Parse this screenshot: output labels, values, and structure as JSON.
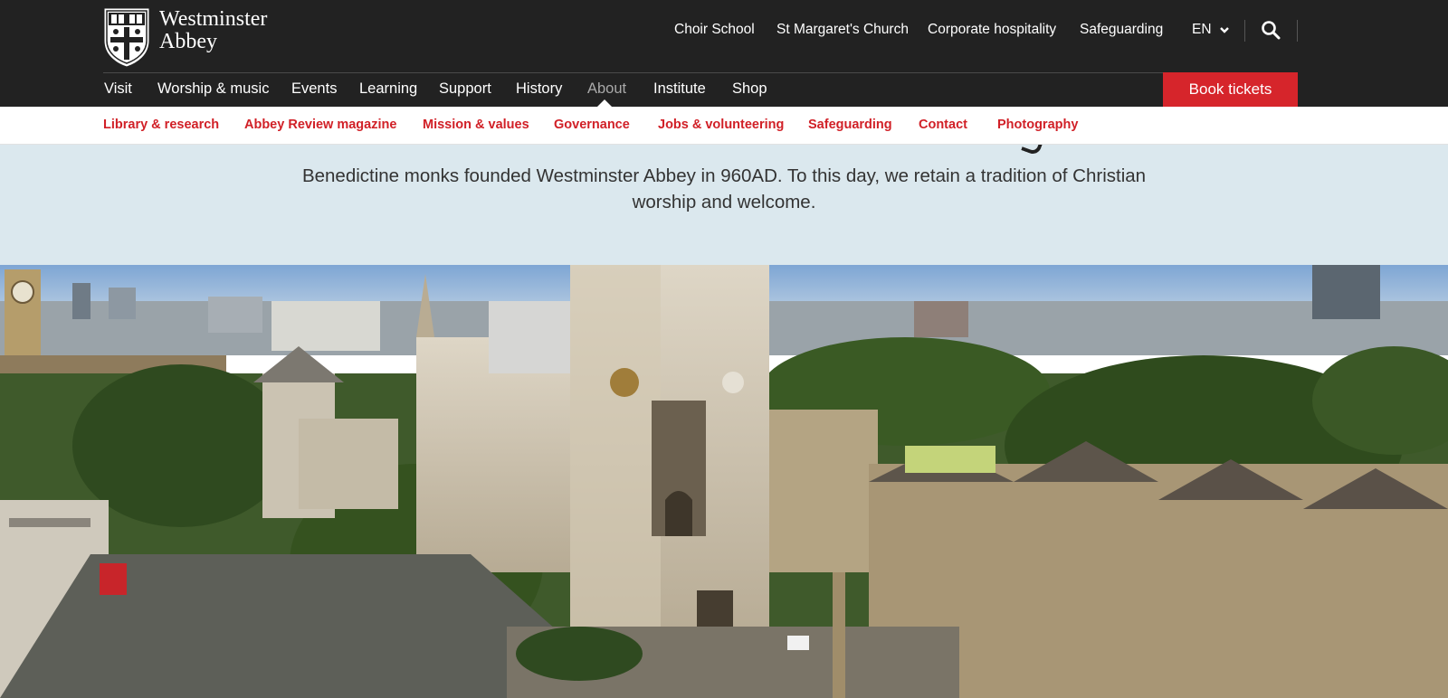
{
  "brand": {
    "line1": "Westminster",
    "line2": "Abbey"
  },
  "utility_nav": {
    "links": [
      "Choir School",
      "St Margaret's Church",
      "Corporate hospitality",
      "Safeguarding"
    ],
    "language": "EN"
  },
  "main_nav": {
    "items": [
      "Visit",
      "Worship & music",
      "Events",
      "Learning",
      "Support",
      "History",
      "About",
      "Institute",
      "Shop"
    ],
    "active": "About",
    "cta": "Book tickets"
  },
  "sub_nav": {
    "items": [
      "Library & research",
      "Abbey Review magazine",
      "Mission & values",
      "Governance",
      "Jobs & volunteering",
      "Safeguarding",
      "Contact",
      "Photography"
    ]
  },
  "intro": {
    "text": "Benedictine monks founded Westminster Abbey in 960AD. To this day, we retain a tradition of Christian worship and welcome."
  },
  "colors": {
    "header_bg": "#222222",
    "accent_red": "#d6252b",
    "link_red": "#d12027",
    "intro_bg": "#dbe8ee"
  },
  "icons": {
    "search": "search-icon",
    "chevron": "chevron-down-icon",
    "logo": "abbey-shield-logo"
  }
}
